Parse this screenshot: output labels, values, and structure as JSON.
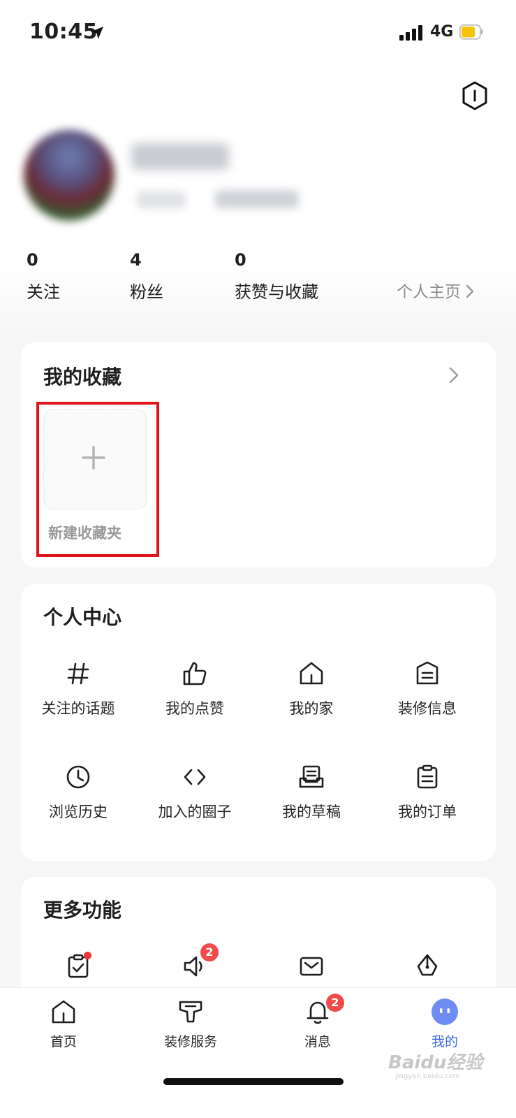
{
  "status_bar": {
    "time": "10:45",
    "network": "4G",
    "battery_color": "#f5c400"
  },
  "profile": {
    "stats": [
      {
        "count": "0",
        "label": "关注"
      },
      {
        "count": "4",
        "label": "粉丝"
      },
      {
        "count": "0",
        "label": "获赞与收藏"
      }
    ],
    "homepage_link": "个人主页"
  },
  "favorites": {
    "title": "我的收藏",
    "new_folder_label": "新建收藏夹",
    "highlight_color": "#e1141c"
  },
  "personal_center": {
    "title": "个人中心",
    "items": [
      {
        "label": "关注的话题",
        "icon": "hash-icon"
      },
      {
        "label": "我的点赞",
        "icon": "thumbs-up-icon"
      },
      {
        "label": "我的家",
        "icon": "home-icon"
      },
      {
        "label": "装修信息",
        "icon": "document-icon"
      },
      {
        "label": "浏览历史",
        "icon": "clock-icon"
      },
      {
        "label": "加入的圈子",
        "icon": "code-brackets-icon"
      },
      {
        "label": "我的草稿",
        "icon": "draft-tray-icon"
      },
      {
        "label": "我的订单",
        "icon": "clipboard-icon"
      }
    ]
  },
  "more_features": {
    "title": "更多功能",
    "items": [
      {
        "icon": "task-clipboard-icon",
        "has_dot": true
      },
      {
        "icon": "megaphone-icon",
        "badge": "2"
      },
      {
        "icon": "envelope-icon"
      },
      {
        "icon": "pen-nib-icon"
      }
    ]
  },
  "tabbar": {
    "accent_color": "#3f6de6",
    "tabs": [
      {
        "label": "首页",
        "icon": "home-icon"
      },
      {
        "label": "装修服务",
        "icon": "service-icon"
      },
      {
        "label": "消息",
        "icon": "bell-icon",
        "badge": "2"
      },
      {
        "label": "我的",
        "icon": "avatar-face-icon",
        "active": true
      }
    ]
  },
  "watermark": {
    "text": "Baidu经验",
    "sub": "jingyan.baidu.com"
  }
}
